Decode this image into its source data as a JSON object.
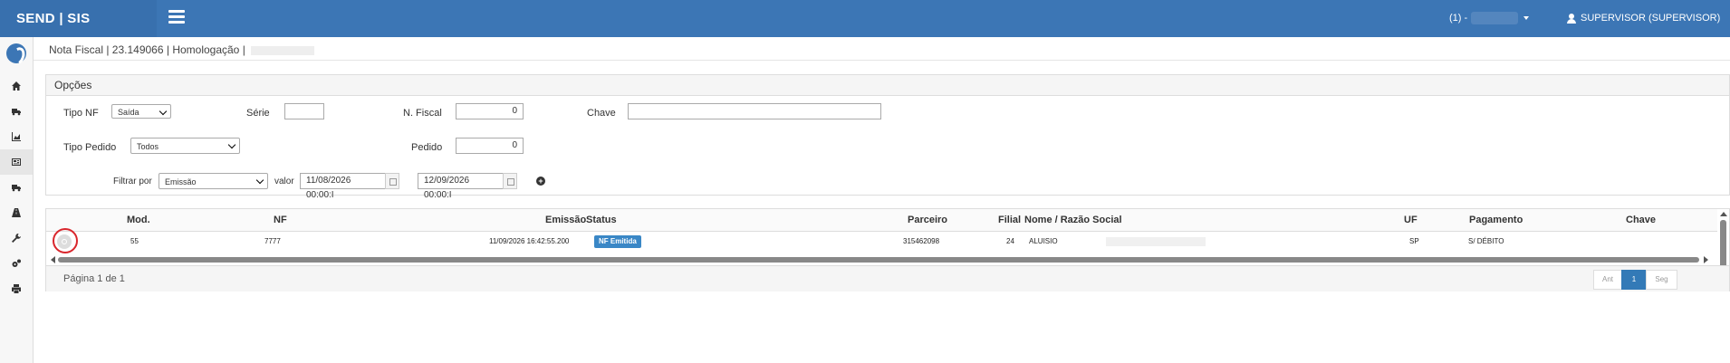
{
  "topbar": {
    "brand": "SEND | SIS",
    "unit": "(1) -",
    "user": "SUPERVISOR (SUPERVISOR)"
  },
  "breadcrumb": "Nota Fiscal | 23.149066 | Homologação |",
  "panel": {
    "title": "Opções",
    "tipo_nf_label": "Tipo NF",
    "tipo_nf_value": "Saída",
    "serie_label": "Série",
    "serie_value": "",
    "n_fiscal_label": "N. Fiscal",
    "n_fiscal_value": "0",
    "chave_label": "Chave",
    "chave_value": "",
    "tipo_pedido_label": "Tipo Pedido",
    "tipo_pedido_value": "Todos",
    "pedido_label": "Pedido",
    "pedido_value": "0",
    "filtrar_label": "Filtrar por",
    "filtrar_value": "Emissão",
    "valor_label": "valor",
    "date_from": "11/08/2026 00:00:I",
    "date_to": "12/09/2026 00:00:I"
  },
  "grid": {
    "headers": {
      "mod": "Mod.",
      "nf": "NF",
      "emissao": "Emissão",
      "status": "Status",
      "parceiro": "Parceiro",
      "filial": "Filial",
      "nome": "Nome / Razão Social",
      "uf": "UF",
      "pagamento": "Pagamento",
      "chave": "Chave"
    },
    "rows": [
      {
        "mod": "55",
        "nf": "7777",
        "emissao": "11/09/2026 16:42:55.200",
        "status": "NF Emitida",
        "parceiro": "315462098",
        "filial": "24",
        "nome": "ALUISIO",
        "uf": "SP",
        "pagamento": "S/ DÉBITO"
      }
    ],
    "page_info": "Página 1 de 1",
    "pager": {
      "prev": "Ant",
      "current": "1",
      "next": "Seg"
    }
  },
  "colors": {
    "topbar": "#3c76b5",
    "badge": "#3a87c6",
    "highlight": "#d9262c"
  },
  "icons": [
    "menu-icon",
    "user-icon",
    "logo-icon",
    "home-icon",
    "truck-icon",
    "chart-icon",
    "invoice-icon",
    "truck-icon",
    "road-icon",
    "wrench-icon",
    "gears-icon",
    "printer-icon",
    "plus-circle-icon",
    "calendar-icon",
    "view-icon"
  ]
}
